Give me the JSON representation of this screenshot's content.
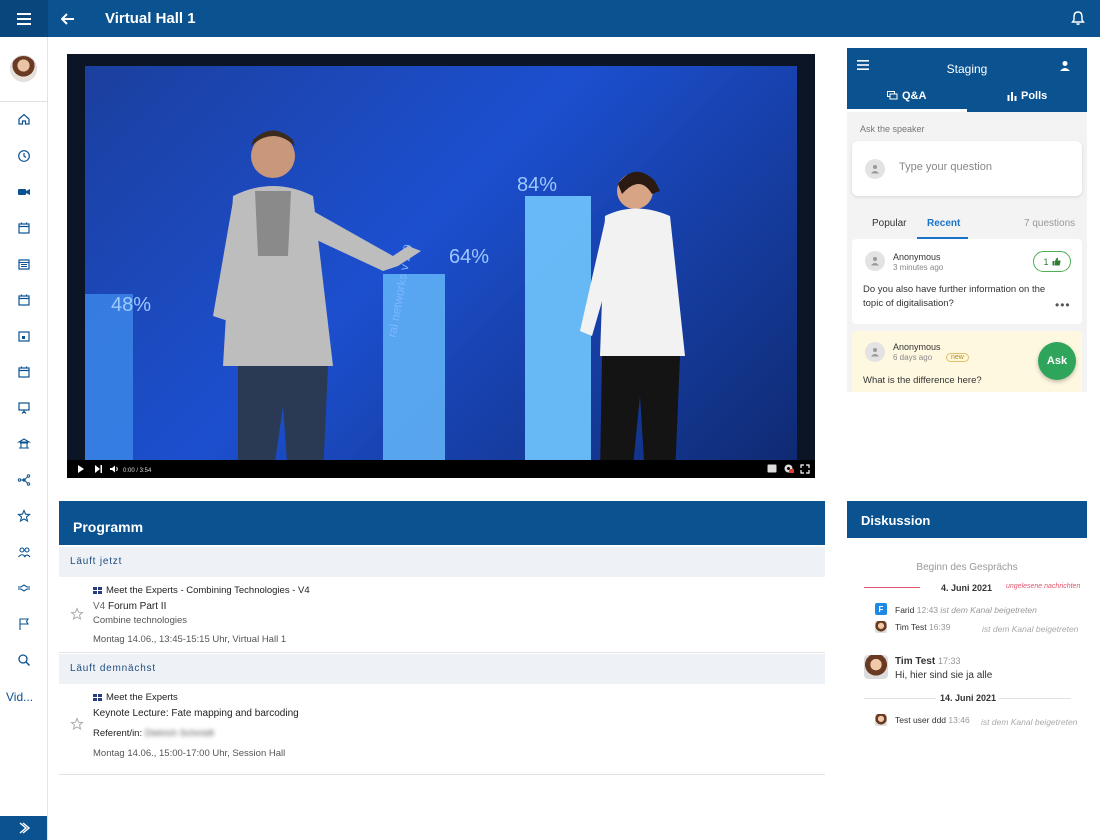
{
  "header": {
    "title": "Virtual Hall 1"
  },
  "sidebar": {
    "more_label": "Vid..."
  },
  "video": {
    "time": "0:00 / 3:54",
    "progress": 0.34,
    "screen_values": [
      "48%",
      "64%",
      "84%"
    ],
    "screen_text": "ral networks v 2.0"
  },
  "qa": {
    "panel_title": "Staging",
    "tabs": [
      {
        "label": "Q&A"
      },
      {
        "label": "Polls"
      }
    ],
    "ask_label": "Ask the speaker",
    "input_placeholder": "Type your question",
    "sort_tabs": [
      {
        "label": "Popular"
      },
      {
        "label": "Recent"
      }
    ],
    "count": "7 questions",
    "questions": [
      {
        "author": "Anonymous",
        "time": "3 minutes ago",
        "likes": "1",
        "text": "Do you also have further information on the topic of digitalisation?"
      },
      {
        "author": "Anonymous",
        "time": "6 days ago",
        "badge": "new",
        "text": "What is the difference here?"
      }
    ],
    "ask_button": "Ask"
  },
  "program": {
    "title": "Programm",
    "sections": [
      {
        "label": "Läuft jetzt",
        "event": {
          "series": "Meet the Experts - Combining Technologies - V4",
          "room_code": "V4",
          "title": "Forum Part II",
          "subtitle": "Combine technologies",
          "meta": "Montag 14.06., 13:45-15:15 Uhr, Virtual Hall 1"
        }
      },
      {
        "label": "Läuft demnächst",
        "event": {
          "series": "Meet the Experts",
          "title": "Keynote Lecture: Fate mapping and barcoding",
          "speaker_label": "Referent/in:",
          "speaker": "Dietrich Schmidt",
          "meta": "Montag 14.06., 15:00-17:00 Uhr, Session Hall"
        }
      }
    ]
  },
  "discussion": {
    "title": "Diskussion",
    "begin": "Beginn des Gesprächs",
    "dates": [
      "4. Juni 2021",
      "14. Juni 2021"
    ],
    "unread": "ungelesene nachrichten",
    "messages": [
      {
        "name": "Farid",
        "time": "12:43",
        "text": "ist dem Kanal beigetreten"
      },
      {
        "name": "Tim Test",
        "time": "16:39",
        "text": "ist dem Kanal beigetreten"
      },
      {
        "name": "Tim Test",
        "time": "17:33",
        "text": "Hi, hier sind sie ja alle"
      },
      {
        "name": "Test user ddd",
        "time": "13:46",
        "text": "ist dem Kanal beigetreten"
      }
    ]
  },
  "colors": {
    "primary": "#0a5290",
    "green": "#2ea55a",
    "unread": "#e0566c"
  }
}
